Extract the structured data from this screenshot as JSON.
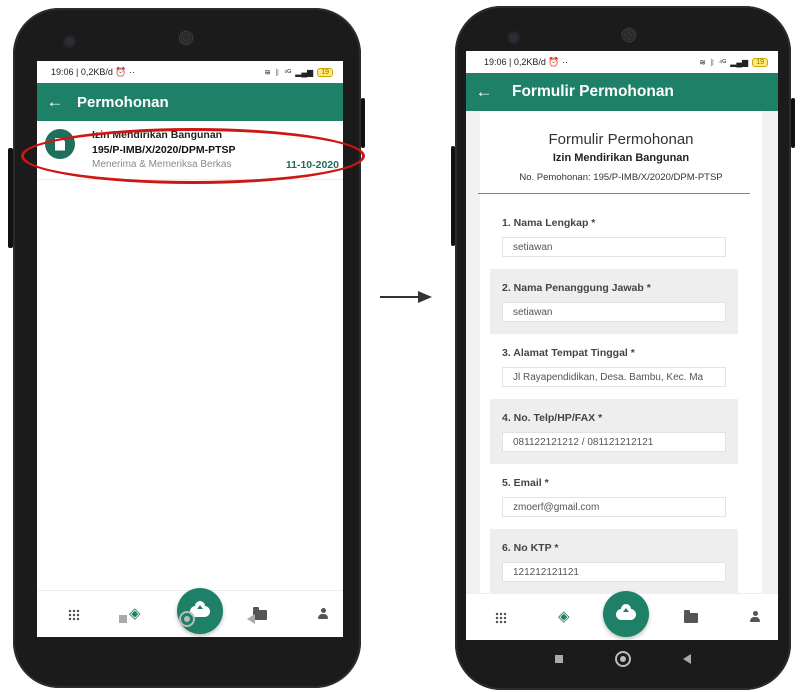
{
  "status_bar": {
    "time_info": "19:06 | 0,2KB/d",
    "extra": "··",
    "network": "⁴ᴳ",
    "battery": "19"
  },
  "left_screen": {
    "appbar_title": "Permohonan",
    "list": [
      {
        "title": "Izin Mendirikan Bangunan",
        "number": "195/P-IMB/X/2020/DPM-PTSP",
        "status": "Menerima & Memeriksa Berkas",
        "date": "11-10-2020"
      }
    ]
  },
  "right_screen": {
    "appbar_title": "Formulir Permohonan",
    "form": {
      "title": "Formulir Permohonan",
      "subtitle": "Izin Mendirikan Bangunan",
      "number": "No. Pemohonan: 195/P-IMB/X/2020/DPM-PTSP",
      "fields": [
        {
          "label": "1. Nama Lengkap *",
          "value": "setiawan"
        },
        {
          "label": "2. Nama Penanggung Jawab *",
          "value": "setiawan"
        },
        {
          "label": "3. Alamat Tempat Tinggal *",
          "value": "Jl Rayapendidikan, Desa. Bambu, Kec. Ma"
        },
        {
          "label": "4. No. Telp/HP/FAX *",
          "value": "081122121212 / 081121212121"
        },
        {
          "label": "5. Email *",
          "value": "zmoerf@gmail.com"
        },
        {
          "label": "6. No KTP *",
          "value": "121212121121"
        }
      ]
    }
  },
  "icons": {
    "back": "arrow-left-icon",
    "document": "document-icon",
    "grid": "grid-icon",
    "layers": "layers-icon",
    "upload": "cloud-upload-icon",
    "folder": "folder-icon",
    "person": "person-icon"
  },
  "colors": {
    "primary": "#1e8066",
    "date": "#1e6f5c",
    "highlight": "#d01515"
  }
}
